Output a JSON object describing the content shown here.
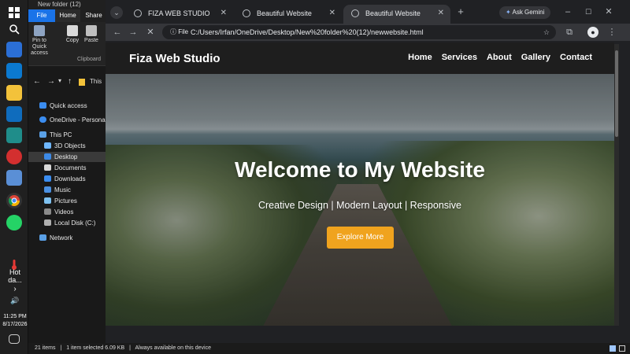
{
  "explorer": {
    "title": "New folder (12)",
    "tabs": [
      "File",
      "Home",
      "Share"
    ],
    "ribbon": {
      "pin_label": "Pin to Quick access",
      "copy_label": "Copy",
      "paste_label": "Paste",
      "group_label": "Clipboard"
    },
    "address_crumb": "This",
    "tree": [
      {
        "label": "Quick access"
      },
      {
        "label": "OneDrive - Personal"
      },
      {
        "label": "This PC"
      },
      {
        "label": "3D Objects"
      },
      {
        "label": "Desktop"
      },
      {
        "label": "Documents"
      },
      {
        "label": "Downloads"
      },
      {
        "label": "Music"
      },
      {
        "label": "Pictures"
      },
      {
        "label": "Videos"
      },
      {
        "label": "Local Disk (C:)"
      },
      {
        "label": "Network"
      }
    ],
    "status": {
      "items": "21 items",
      "selected": "1 item selected  6.09 KB",
      "availability": "Always available on this device"
    }
  },
  "taskbar": {
    "weather": "Hot da...",
    "time": "11:25 PM",
    "date": "8/17/2026"
  },
  "browser": {
    "tabs": [
      {
        "title": "FIZA WEB STUDIO"
      },
      {
        "title": "Beautiful Website"
      },
      {
        "title": "Beautiful Website"
      }
    ],
    "ask_gemini": "Ask Gemini",
    "url_chip": "File",
    "url": "C:/Users/Irfan/OneDrive/Desktop/New%20folder%20(12)/newwebsite.html"
  },
  "site": {
    "brand": "Fiza Web Studio",
    "menu": [
      "Home",
      "Services",
      "About",
      "Gallery",
      "Contact"
    ],
    "hero_title": "Welcome to My Website",
    "hero_subtitle": "Creative Design | Modern Layout | Responsive",
    "cta": "Explore More",
    "accent": "#f0a31e"
  }
}
